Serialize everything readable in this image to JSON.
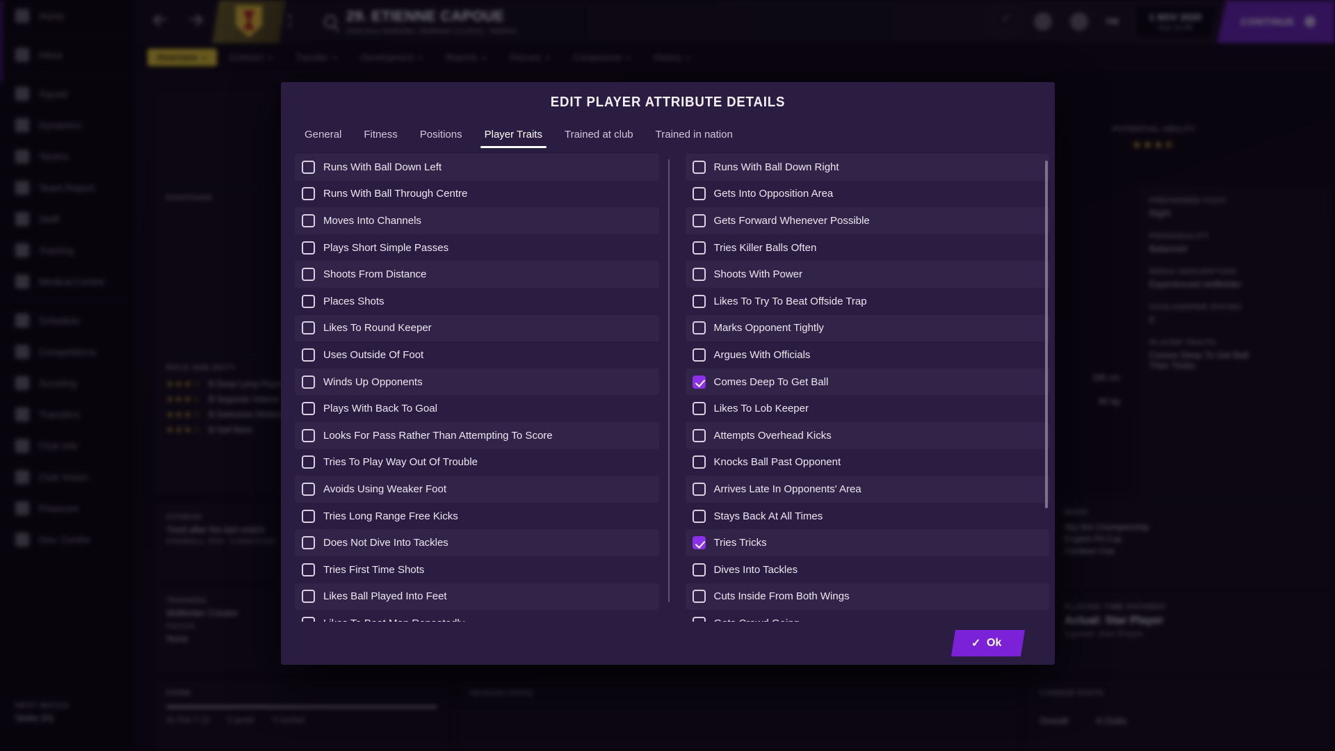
{
  "app": {
    "sidebar": {
      "items": [
        {
          "label": "Home",
          "icon": "home-icon"
        },
        {
          "label": "Inbox",
          "icon": "inbox-icon"
        },
        {
          "label": "Squad",
          "icon": "shirt-icon"
        },
        {
          "label": "Dynamics",
          "icon": "dynamics-icon"
        },
        {
          "label": "Tactics",
          "icon": "tactics-icon"
        },
        {
          "label": "Team Report",
          "icon": "report-icon"
        },
        {
          "label": "Staff",
          "icon": "staff-icon"
        },
        {
          "label": "Training",
          "icon": "training-icon"
        },
        {
          "label": "Medical Centre",
          "icon": "medical-icon"
        },
        {
          "label": "Schedule",
          "icon": "calendar-icon"
        },
        {
          "label": "Competitions",
          "icon": "trophy-icon"
        },
        {
          "label": "Scouting",
          "icon": "scouting-icon"
        },
        {
          "label": "Transfers",
          "icon": "transfers-icon"
        },
        {
          "label": "Club Info",
          "icon": "club-icon"
        },
        {
          "label": "Club Vision",
          "icon": "vision-icon"
        },
        {
          "label": "Finances",
          "icon": "finances-icon"
        },
        {
          "label": "Dev. Centre",
          "icon": "dev-centre-icon"
        }
      ],
      "next_match_label": "NEXT MATCH",
      "next_match_value": "Stoke (H)"
    },
    "header": {
      "player_name": "29. ETIENNE CAPOUE",
      "player_subtitle": "Defensive Midfielder, Midfielder (Centre) - Watford",
      "fm_badge": "FM",
      "date": "1 NOV 2020",
      "time": "Sun 11:05",
      "continue_label": "CONTINUE"
    },
    "tabs": [
      {
        "label": "Overview",
        "active": true
      },
      {
        "label": "Contract",
        "active": false
      },
      {
        "label": "Transfer",
        "active": false
      },
      {
        "label": "Development",
        "active": false
      },
      {
        "label": "Reports",
        "active": false
      },
      {
        "label": "Discuss",
        "active": false
      },
      {
        "label": "Comparison",
        "active": false
      },
      {
        "label": "History",
        "active": false
      }
    ],
    "left_panels": {
      "positions_label": "POSITIONS",
      "role_duty_label": "ROLE AND DUTY",
      "role_rows": [
        {
          "stars": "★★★☆",
          "text": "B Deep Lying Playmaker"
        },
        {
          "stars": "★★★☆",
          "text": "B Segundo Volante"
        },
        {
          "stars": "★★★☆",
          "text": "B Defensive Midfielder"
        },
        {
          "stars": "★★★☆",
          "text": "B Half Back"
        }
      ],
      "fitness_label": "FITNESS",
      "fitness_text": "Tired after his last match",
      "fitness_sub": "OVERALL PHY. CONDITION",
      "training_label": "TRAINING",
      "training_value": "Midfielder Creator",
      "training_focus_label": "FOCUS",
      "training_focus_value": "None"
    },
    "right_panels": {
      "potential_ability_label": "POTENTIAL ABILITY",
      "potential_ability_stars": "★★★⯪",
      "preferred_foot_label": "PREFERRED FOOT",
      "preferred_foot_value": "Right",
      "personality_label": "PERSONALITY",
      "personality_value": "Balanced",
      "media_description_label": "MEDIA DESCRIPTION",
      "media_description_value": "Experienced midfielder",
      "goalkeeper_rating_label": "GOALKEEPER RATING",
      "goalkeeper_rating_value": "0",
      "player_traits_label": "PLAYER TRAITS",
      "player_traits_values": "Comes Deep To Get Ball\nTries Tricks",
      "height": "185 cm",
      "weight": "80 kg",
      "bans_label": "BANS",
      "bans": [
        "Sky Bet Championship",
        "English FA Cup",
        "Carabao Cup"
      ],
      "playing_time_label": "PLAYING TIME PATHWAY",
      "playing_time_value": "Actual: Star Player",
      "playing_time_sub": "Agreed: Star Player"
    },
    "bottom_panels": {
      "form_label": "FORM",
      "form_stats": [
        "Av Rat 7.10",
        "0 goals",
        "0 assists"
      ],
      "season_stats_label": "SEASON STATS",
      "career_stats_label": "CAREER STATS",
      "career_overall": "Overall",
      "career_clubs": "4 Clubs"
    }
  },
  "modal": {
    "title": "EDIT PLAYER ATTRIBUTE DETAILS",
    "tabs": [
      {
        "label": "General",
        "active": false
      },
      {
        "label": "Fitness",
        "active": false
      },
      {
        "label": "Positions",
        "active": false
      },
      {
        "label": "Player Traits",
        "active": true
      },
      {
        "label": "Trained at club",
        "active": false
      },
      {
        "label": "Trained in nation",
        "active": false
      }
    ],
    "ok_label": "Ok",
    "ok_icon": "check-icon",
    "colors": {
      "accent": "#8b2fe8",
      "modal_bg": "#2b1d42",
      "ok_button": "#7b22d8",
      "continue_button": "#6b22c4",
      "active_tab_yellow": "#e0c327"
    },
    "traits_left": [
      {
        "label": "Runs With Ball Down Left",
        "checked": false
      },
      {
        "label": "Runs With Ball Through Centre",
        "checked": false
      },
      {
        "label": "Moves Into Channels",
        "checked": false
      },
      {
        "label": "Plays Short Simple Passes",
        "checked": false
      },
      {
        "label": "Shoots From Distance",
        "checked": false
      },
      {
        "label": "Places Shots",
        "checked": false
      },
      {
        "label": "Likes To Round Keeper",
        "checked": false
      },
      {
        "label": "Uses Outside Of Foot",
        "checked": false
      },
      {
        "label": "Winds Up Opponents",
        "checked": false
      },
      {
        "label": "Plays With Back To Goal",
        "checked": false
      },
      {
        "label": "Looks For Pass Rather Than Attempting To Score",
        "checked": false
      },
      {
        "label": "Tries To Play Way Out Of Trouble",
        "checked": false
      },
      {
        "label": "Avoids Using Weaker Foot",
        "checked": false
      },
      {
        "label": "Tries Long Range Free Kicks",
        "checked": false
      },
      {
        "label": "Does Not Dive Into Tackles",
        "checked": false
      },
      {
        "label": "Tries First Time Shots",
        "checked": false
      },
      {
        "label": "Likes Ball Played Into Feet",
        "checked": false
      },
      {
        "label": "Likes To Beat Man Repeatedly",
        "checked": false
      }
    ],
    "traits_right": [
      {
        "label": "Runs With Ball Down Right",
        "checked": false
      },
      {
        "label": "Gets Into Opposition Area",
        "checked": false
      },
      {
        "label": "Gets Forward Whenever Possible",
        "checked": false
      },
      {
        "label": "Tries Killer Balls Often",
        "checked": false
      },
      {
        "label": "Shoots With Power",
        "checked": false
      },
      {
        "label": "Likes To Try To Beat Offside Trap",
        "checked": false
      },
      {
        "label": "Marks Opponent Tightly",
        "checked": false
      },
      {
        "label": "Argues With Officials",
        "checked": false
      },
      {
        "label": "Comes Deep To Get Ball",
        "checked": true
      },
      {
        "label": "Likes To Lob Keeper",
        "checked": false
      },
      {
        "label": "Attempts Overhead Kicks",
        "checked": false
      },
      {
        "label": "Knocks Ball Past Opponent",
        "checked": false
      },
      {
        "label": "Arrives Late In Opponents' Area",
        "checked": false
      },
      {
        "label": "Stays Back At All Times",
        "checked": false
      },
      {
        "label": "Tries Tricks",
        "checked": true
      },
      {
        "label": "Dives Into Tackles",
        "checked": false
      },
      {
        "label": "Cuts Inside From Both Wings",
        "checked": false
      },
      {
        "label": "Gets Crowd Going",
        "checked": false
      }
    ]
  }
}
